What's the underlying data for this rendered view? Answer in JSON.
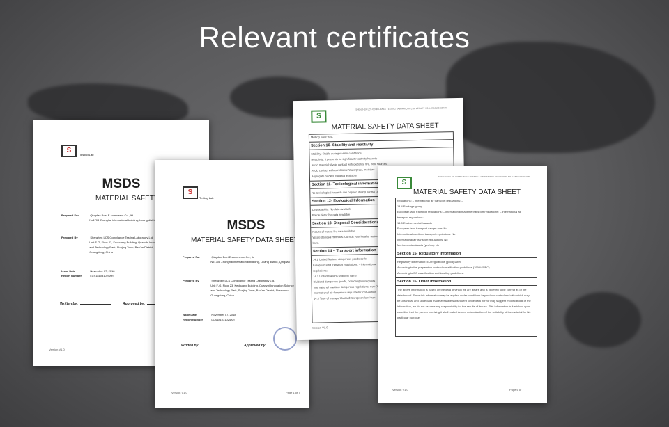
{
  "heading": "Relevant certificates",
  "cover": {
    "testing_lab": "Testing Lab",
    "msds": "MSDS",
    "subtitle": "MATERIAL SAFETY DATA SHEET",
    "prepared_for_label": "Prepared For",
    "prepared_for": [
      "Qingdao Boei E-commerce Co., ltd",
      "No1708 Zhonghai international building, Licang district, Qingdao"
    ],
    "prepared_by_label": "Prepared By",
    "prepared_by": [
      "Shenzhen LCS Compliance Testing Laboratory Ltd.",
      "Unit F-G, Floor 23, Kechuang Building, Quanzhi Innovation Science",
      "and Technology Park, Shajing Town, Bao'an District, Shenzhen,",
      "Guangdong, China"
    ],
    "issue_date_label": "Issue Date",
    "issue_date": "November 07, 2018",
    "report_number_label": "Report Number",
    "report_number": "LCS181031024AR",
    "written_by": "Written by:",
    "approved_by": "Approved by:",
    "version": "Version V1.0",
    "page": "Page 1 of 7"
  },
  "sheet_a": {
    "header": "SHENZHEN LCS COMPLIANCE TESTING LABORATORY LTD. REPORT NO. LCS181031024AR",
    "title": "MATERIAL SAFETY DATA SHEET",
    "lines": [
      {
        "t": "Melting point: N/A",
        "s": false
      },
      {
        "t": "Section 10- Stability and reactivity",
        "s": true
      },
      {
        "t": "Stability: Stable during normal conditions.",
        "s": false
      },
      {
        "t": "Reactivity: It presents no significant reactivity hazards.",
        "s": false
      },
      {
        "t": "Avoid material: Avoid contact with oxidants, fire, heat sources",
        "s": false
      },
      {
        "t": "Avoid contact with conditions: Waterproof, moisture",
        "s": false
      },
      {
        "t": "Aggregate hazard: No data available",
        "s": false
      },
      {
        "t": "Section 11- Toxicological information",
        "s": true
      },
      {
        "t": "No toxicological hazards can happen during normal use",
        "s": false
      },
      {
        "t": "Section 12- Ecological Information",
        "s": true
      },
      {
        "t": "Degradability: No data available",
        "s": false
      },
      {
        "t": "Precautions: No data available",
        "s": false
      },
      {
        "t": "Section 13- Disposal Considerations",
        "s": true
      },
      {
        "t": "Nature of waste: No data available",
        "s": false
      },
      {
        "t": "Waste disposal methods: Consult your local or regional",
        "s": false
      },
      {
        "t": "laws.",
        "s": false
      },
      {
        "t": "Section 14 – Transport information",
        "s": true
      },
      {
        "t": "14.1 United Nations dangerous goods code",
        "s": false
      },
      {
        "t": "European land transport regulations: – international",
        "s": false
      },
      {
        "t": "regulations: –",
        "s": false
      },
      {
        "t": "14.2 United Nations shipping name",
        "s": false
      },
      {
        "t": "Dividend dangerous goods, non-dangerous goods",
        "s": false
      },
      {
        "t": "International maritime dangerous regulations: non-D",
        "s": false
      },
      {
        "t": "International air dangerous regulations: non-dange",
        "s": false
      },
      {
        "t": "14.3 Type of transport hazard: European land tran",
        "s": false
      }
    ],
    "version": "Version V1.0"
  },
  "sheet_b": {
    "header": "SHENZHEN LCS COMPLIANCE TESTING LABORATORY LTD. REPORT NO. LCS181031024AR",
    "title": "MATERIAL SAFETY DATA SHEET",
    "lines": [
      {
        "t": "regulations: – international air transport regulations: –",
        "s": false
      },
      {
        "t": "14.4 Package group",
        "s": false
      },
      {
        "t": "European land transport regulations: – international maritime transport regulations: – international air",
        "s": false
      },
      {
        "t": "transport regulations: –",
        "s": false
      },
      {
        "t": "14.5 Environmental hazards",
        "s": false
      },
      {
        "t": "European land transport danger rule: No",
        "s": false
      },
      {
        "t": "International maritime transport regulations: No",
        "s": false
      },
      {
        "t": "International air transport regulations: No",
        "s": false
      },
      {
        "t": "Marine contaminants (yes/no): No",
        "s": false
      },
      {
        "t": "Section 15- Regulatory information",
        "s": true
      },
      {
        "t": "Regulatory information: EU regulations (good) label",
        "s": false
      },
      {
        "t": "According to the preparation method classification guidelines (1999/45/EC)",
        "s": false
      },
      {
        "t": "According to EC classification and labeling guidelines.",
        "s": false
      },
      {
        "t": "Section 16- Other information",
        "s": true
      },
      {
        "t": "The above information is based on the data of which we are aware and is believed to be correct as of the",
        "s": false
      },
      {
        "t": "data hereof. Since this information may be applied under conditions beyond our control and with which may",
        "s": false
      },
      {
        "t": "be unfamiliar and since data made available subsequent to the data hereof may suggest modifications of the",
        "s": false
      },
      {
        "t": "information, we do not assume any responsibility for the results of its use. This information is furnished upon",
        "s": false
      },
      {
        "t": "condition that the person receiving it shall make his own determination of the suitability of the material for his",
        "s": false
      },
      {
        "t": "particular purpose.",
        "s": false
      }
    ],
    "version": "Version V1.0",
    "page": "Page 6 of 7"
  }
}
